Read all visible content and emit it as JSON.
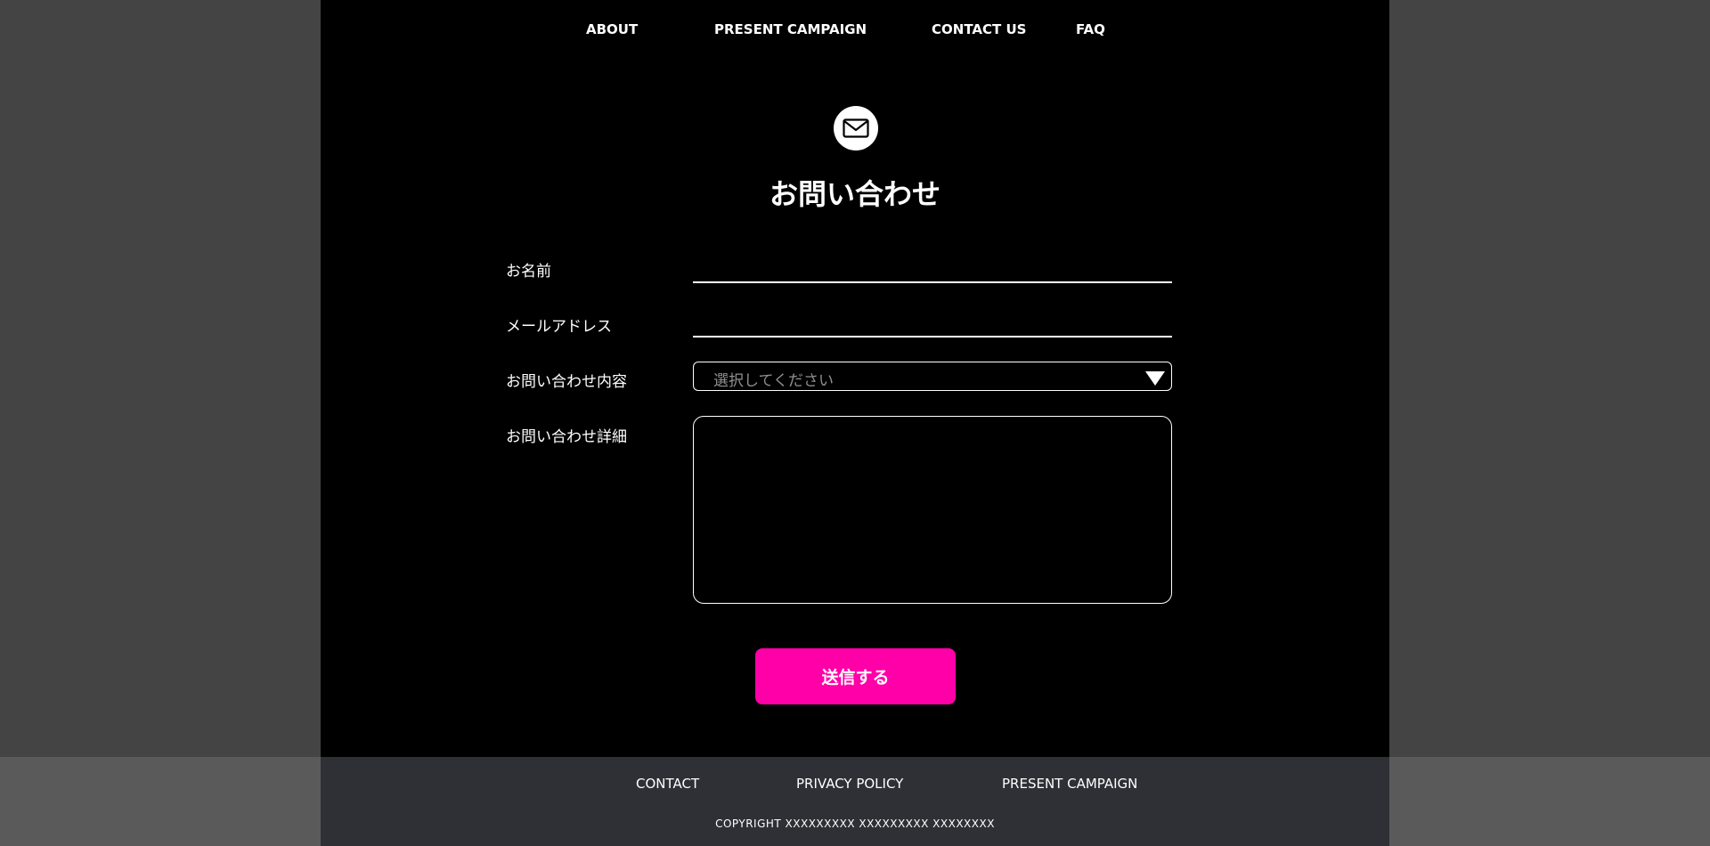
{
  "nav": {
    "items": [
      {
        "label": "ABOUT"
      },
      {
        "label": "PRESENT CAMPAIGN"
      },
      {
        "label": "CONTACT US"
      },
      {
        "label": "FAQ"
      }
    ]
  },
  "header": {
    "icon": "mail-icon",
    "title": "お問い合わせ"
  },
  "form": {
    "name_label": "お名前",
    "name_value": "",
    "email_label": "メールアドレス",
    "email_value": "",
    "type_label": "お問い合わせ内容",
    "type_placeholder": "選択してください",
    "detail_label": "お問い合わせ詳細",
    "detail_value": "",
    "submit_label": "送信する"
  },
  "footer": {
    "links": [
      {
        "label": "CONTACT"
      },
      {
        "label": "PRIVACY POLICY"
      },
      {
        "label": "PRESENT CAMPAIGN"
      }
    ],
    "copyright": "COPYRIGHT XXXXXXXXX XXXXXXXXX XXXXXXXX"
  },
  "colors": {
    "background": "#000000",
    "side_background": "#444444",
    "accent": "#ff00a8",
    "footer_background": "#2f2f36"
  }
}
